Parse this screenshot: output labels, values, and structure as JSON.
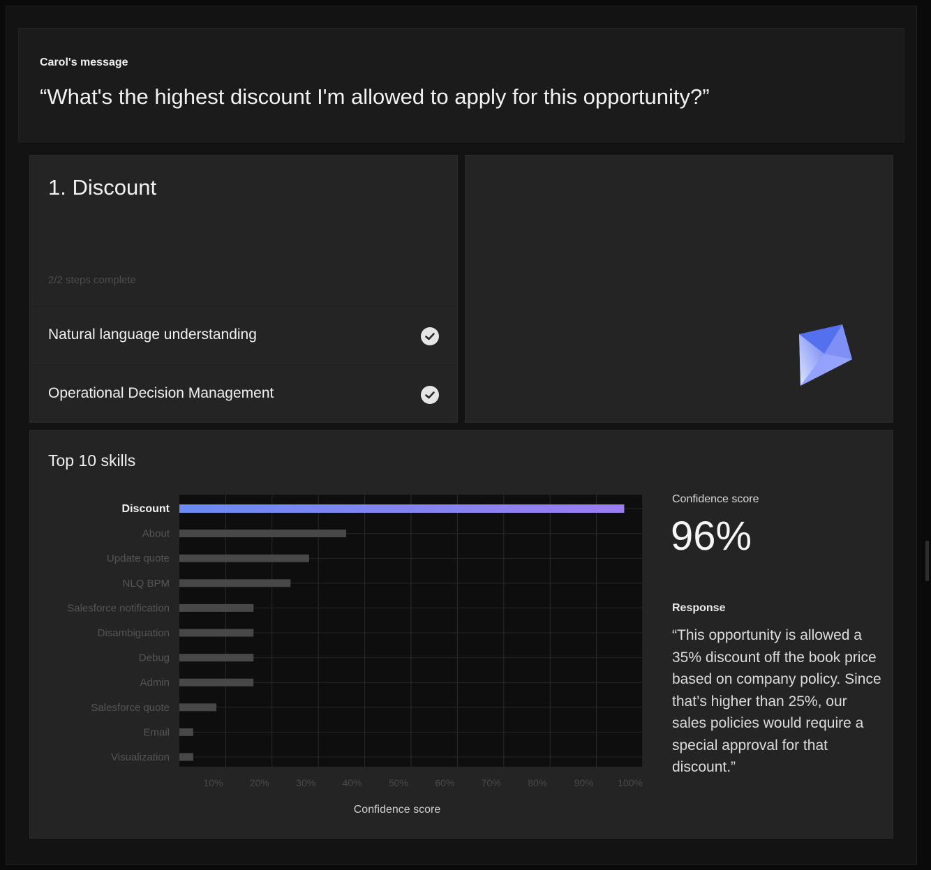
{
  "message": {
    "label": "Carol's message",
    "text": "“What's the highest discount I'm allowed to apply for this opportunity?”"
  },
  "steps": {
    "title": "1. Discount",
    "progress": "2/2 steps complete",
    "items": [
      {
        "label": "Natural language understanding",
        "status": "complete",
        "icon": "check-circle-icon"
      },
      {
        "label": "Operational Decision Management",
        "status": "complete",
        "icon": "check-circle-icon"
      }
    ]
  },
  "visual": {
    "icon": "gem-icon",
    "colors": [
      "#4f6ff0",
      "#8c9cff",
      "#b9c6ff",
      "#6a5de6"
    ]
  },
  "skills": {
    "title": "Top 10 skills",
    "confidence_label": "Confidence score",
    "confidence_value": "96%",
    "response_label": "Response",
    "response_text": "“This opportunity is allowed a 35% discount off the book price based on company policy. Since that’s higher than 25%, our sales policies would require a special approval for that discount.”"
  },
  "chart_data": {
    "type": "bar",
    "orientation": "horizontal",
    "categories": [
      "Discount",
      "About",
      "Update quote",
      "NLQ BPM",
      "Salesforce notification",
      "Disambiguation",
      "Debug",
      "Admin",
      "Salesforce quote",
      "Email",
      "Visualization"
    ],
    "values": [
      96,
      36,
      28,
      24,
      16,
      16,
      16,
      16,
      8,
      3,
      3
    ],
    "highlight": "Discount",
    "highlight_gradient": [
      "#6b8bf2",
      "#9b7df0"
    ],
    "bar_color": "#484848",
    "xticks": [
      "10%",
      "20%",
      "30%",
      "40%",
      "50%",
      "60%",
      "70%",
      "80%",
      "90%",
      "100%"
    ],
    "xlabel": "Confidence score",
    "xlim": [
      0,
      100
    ],
    "grid": true
  }
}
